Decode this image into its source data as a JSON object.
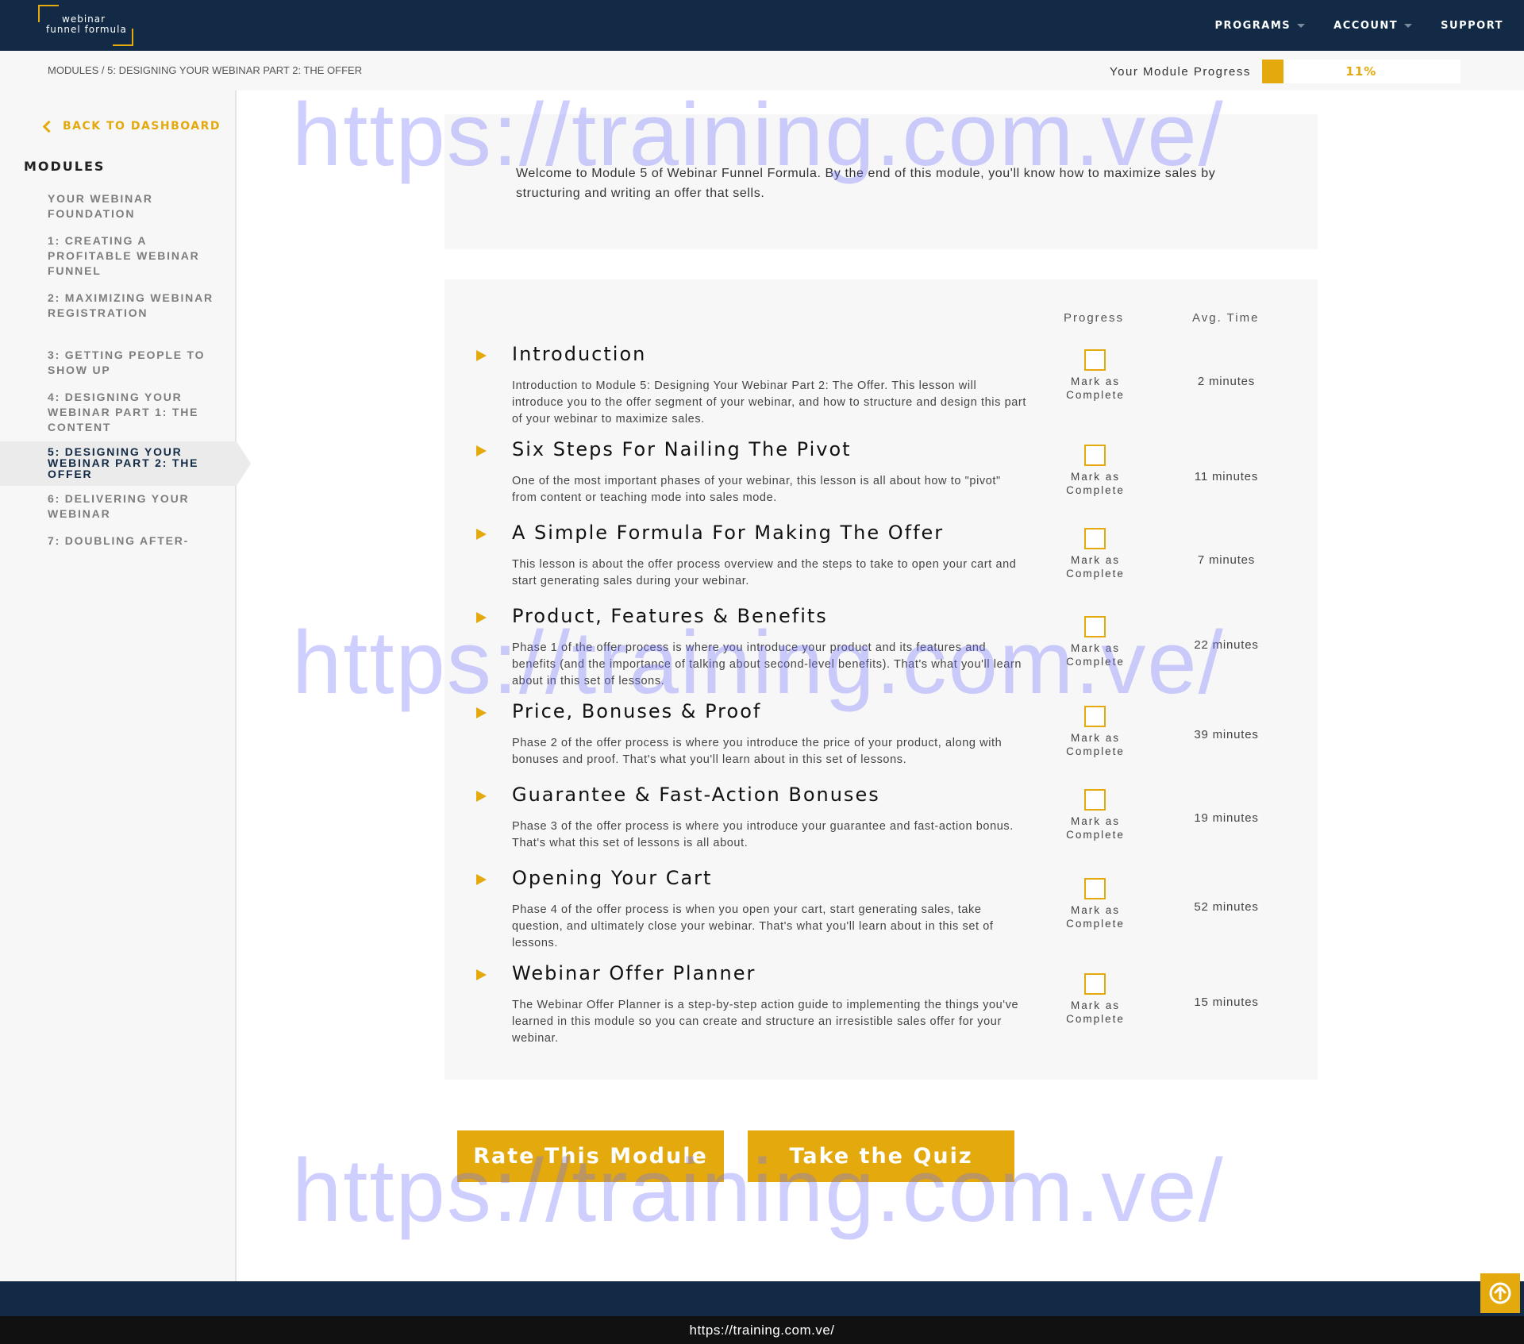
{
  "header": {
    "logo_line1": "webinar",
    "logo_line2": "funnel formula",
    "nav": [
      {
        "label": "PROGRAMS",
        "dropdown": true
      },
      {
        "label": "ACCOUNT",
        "dropdown": true
      },
      {
        "label": "SUPPORT",
        "dropdown": false
      }
    ]
  },
  "subbar": {
    "breadcrumb": "MODULES / 5: DESIGNING YOUR WEBINAR PART 2: THE OFFER",
    "progress_label": "Your Module Progress",
    "progress_text": "11%",
    "progress_value": 0.11
  },
  "sidebar": {
    "back_label": "BACK TO DASHBOARD",
    "modules_heading": "MODULES",
    "items": [
      {
        "label": "YOUR WEBINAR FOUNDATION",
        "active": false
      },
      {
        "label": "1: CREATING A PROFITABLE WEBINAR FUNNEL",
        "active": false
      },
      {
        "label": "2: MAXIMIZING WEBINAR REGISTRATION",
        "active": false
      },
      {
        "label": "3: GETTING PEOPLE TO SHOW UP",
        "active": false
      },
      {
        "label": "4: DESIGNING YOUR WEBINAR PART 1: THE CONTENT",
        "active": false
      },
      {
        "label": "5: DESIGNING YOUR WEBINAR PART 2: THE OFFER",
        "active": true
      },
      {
        "label": "6: DELIVERING YOUR WEBINAR",
        "active": false
      },
      {
        "label": "7: DOUBLING AFTER-",
        "active": false
      }
    ]
  },
  "intro": {
    "text": "Welcome to Module 5 of Webinar Funnel Formula. By the end of this module, you'll know how to maximize sales by structuring and writing an offer that sells."
  },
  "lessons_table": {
    "progress_header": "Progress",
    "time_header": "Avg. Time",
    "mark_label": "Mark as Complete",
    "lessons": [
      {
        "title": "Introduction",
        "description": "Introduction to Module 5: Designing Your Webinar Part 2: The Offer. This lesson will introduce you to the offer segment of your webinar, and how to structure and design this part of your webinar to maximize sales.",
        "time": "2 minutes",
        "complete": false
      },
      {
        "title": "Six Steps For Nailing The Pivot",
        "description": "One of the most important phases of your webinar, this lesson is all about how to \"pivot\" from content or teaching mode into sales mode.",
        "time": "11 minutes",
        "complete": false
      },
      {
        "title": "A Simple Formula For Making The Offer",
        "description": "This lesson is about the offer process overview and the steps to take to open your cart and start generating sales during your webinar.",
        "time": "7 minutes",
        "complete": false
      },
      {
        "title": "Product, Features & Benefits",
        "description": "Phase 1 of the offer process is where you introduce your product and its features and benefits (and the importance of talking about second-level benefits). That's what you'll learn about in this set of lessons.",
        "time": "22 minutes",
        "complete": false
      },
      {
        "title": "Price, Bonuses & Proof",
        "description": "Phase 2 of the offer process is where you introduce the price of your product, along with bonuses and proof. That's what you'll learn about in this set of lessons.",
        "time": "39 minutes",
        "complete": false
      },
      {
        "title": "Guarantee & Fast-Action Bonuses",
        "description": "Phase 3 of the offer process is where you introduce your guarantee and fast-action bonus. That's what this set of lessons is all about.",
        "time": "19 minutes",
        "complete": false
      },
      {
        "title": "Opening Your Cart",
        "description": "Phase 4 of the offer process is when you open your cart, start generating sales, take question, and ultimately close your webinar. That's what you'll learn about in this set of lessons.",
        "time": "52 minutes",
        "complete": false
      },
      {
        "title": "Webinar Offer Planner",
        "description": "The Webinar Offer Planner is a step-by-step action guide to implementing the things you've learned in this module so you can create and structure an irresistible sales offer for your webinar.",
        "time": "15 minutes",
        "complete": false
      }
    ]
  },
  "buttons": {
    "rate": "Rate This Module",
    "quiz": "Take the Quiz"
  },
  "watermark": "https://training.com.ve/",
  "footer_url": "https://training.com.ve/",
  "colors": {
    "navy": "#122a45",
    "accent": "#e3a90d",
    "panel": "#f7f7f7"
  }
}
